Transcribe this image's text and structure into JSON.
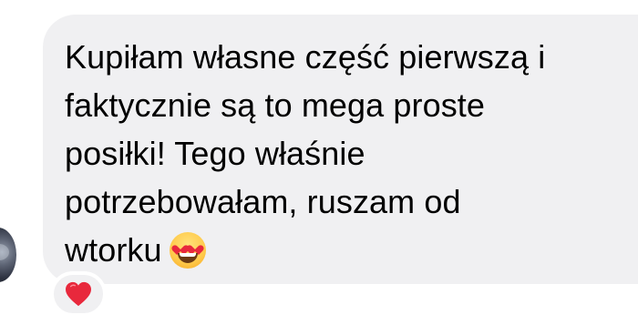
{
  "message": {
    "text": "Kupiłam własne część pierwszą i\nfaktycznie są to mega proste\nposiłki! Tego właśnie\npotrzebowałam, ruszam od\nwtorku",
    "emoji": "smiling-face-with-heart-eyes"
  },
  "reaction": {
    "emoji": "red-heart",
    "color": "#e8283c"
  },
  "colors": {
    "bubble": "#f0f0f2",
    "text": "#000000",
    "background": "#ffffff"
  }
}
